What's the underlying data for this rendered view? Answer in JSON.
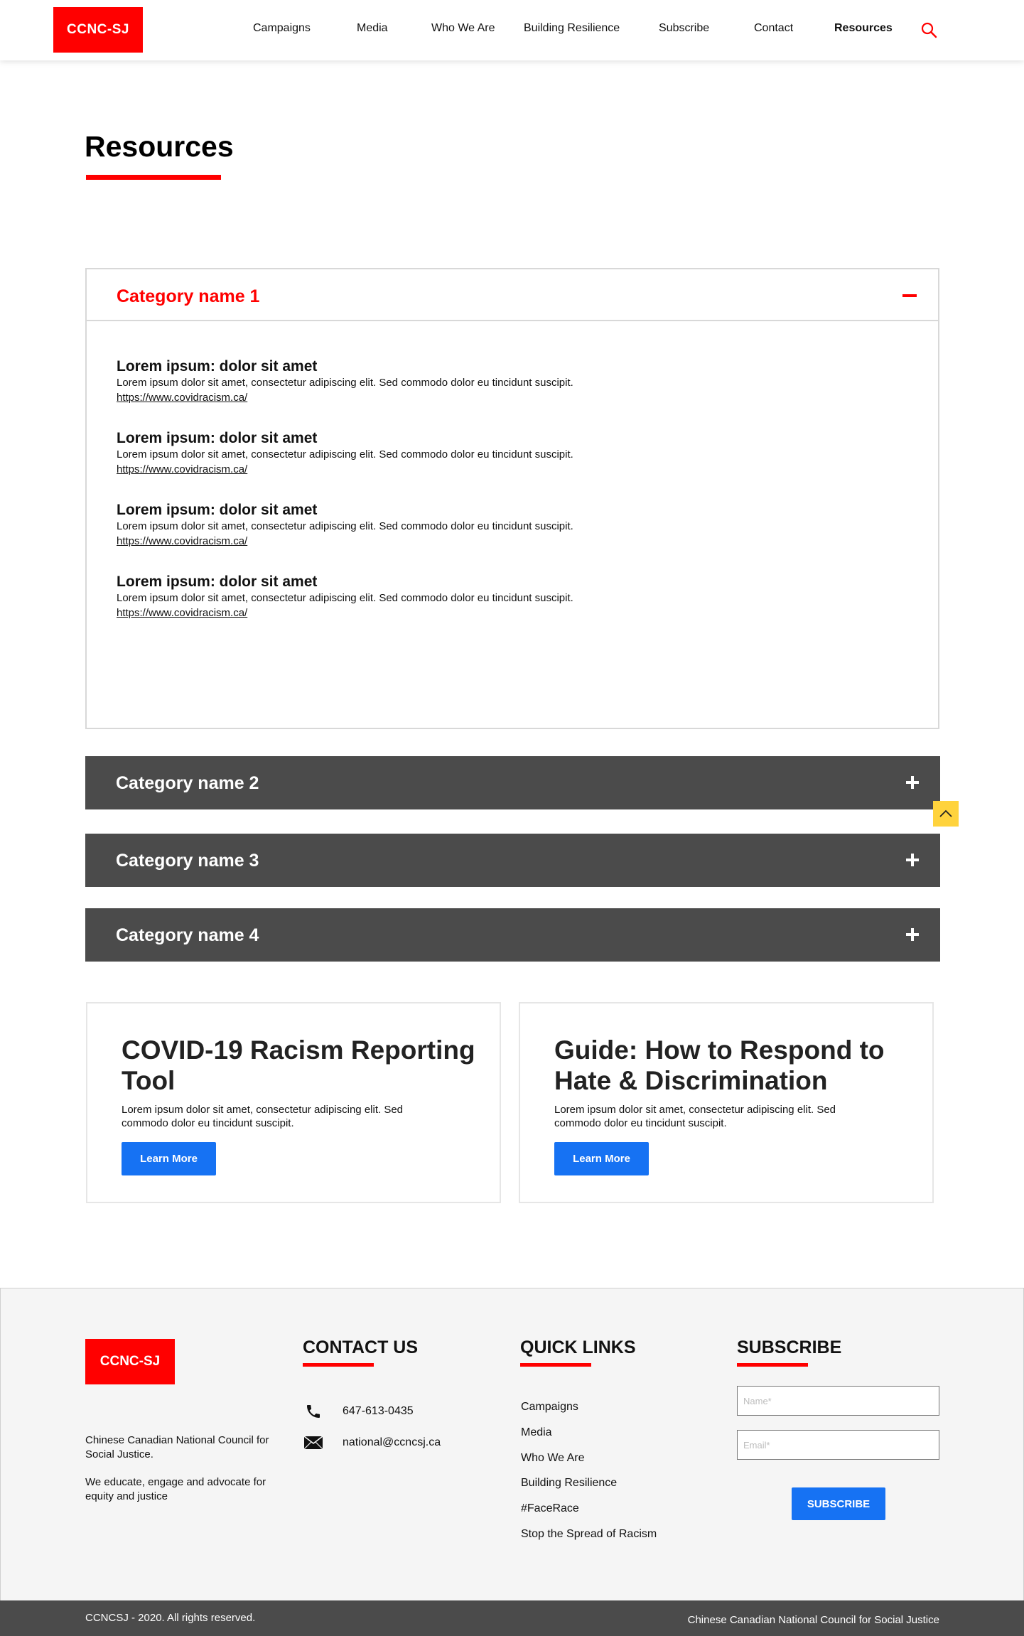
{
  "header": {
    "logo": "CCNC-SJ",
    "nav": [
      "Campaigns",
      "Media",
      "Who We Are",
      "Building Resilience",
      "Subscribe",
      "Contact",
      "Resources"
    ],
    "active_nav": "Resources",
    "search_icon": "search-icon"
  },
  "page": {
    "title": "Resources"
  },
  "accordion": {
    "open": {
      "title": "Category name 1",
      "items": [
        {
          "title": "Lorem ipsum: dolor sit amet",
          "desc": "Lorem ipsum dolor sit amet, consectetur adipiscing elit. Sed commodo dolor eu tincidunt suscipit.",
          "link": "https://www.covidracism.ca/"
        },
        {
          "title": "Lorem ipsum: dolor sit amet",
          "desc": "Lorem ipsum dolor sit amet, consectetur adipiscing elit. Sed commodo dolor eu tincidunt suscipit.",
          "link": "https://www.covidracism.ca/"
        },
        {
          "title": "Lorem ipsum: dolor sit amet",
          "desc": "Lorem ipsum dolor sit amet, consectetur adipiscing elit. Sed commodo dolor eu tincidunt suscipit.",
          "link": "https://www.covidracism.ca/"
        },
        {
          "title": "Lorem ipsum: dolor sit amet",
          "desc": "Lorem ipsum dolor sit amet, consectetur adipiscing elit. Sed commodo dolor eu tincidunt suscipit.",
          "link": "https://www.covidracism.ca/"
        }
      ]
    },
    "closed": [
      "Category name 2",
      "Category name 3",
      "Category name 4"
    ]
  },
  "cards": [
    {
      "title": "COVID-19 Racism Reporting Tool",
      "desc": "Lorem ipsum dolor sit amet, consectetur adipiscing elit. Sed commodo dolor eu tincidunt suscipit.",
      "button": "Learn More"
    },
    {
      "title": "Guide: How to Respond to Hate & Discrimination",
      "desc": "Lorem ipsum dolor sit amet, consectetur adipiscing elit. Sed commodo dolor eu tincidunt suscipit.",
      "button": "Learn More"
    }
  ],
  "footer": {
    "logo": "CCNC-SJ",
    "org_name": "Chinese Canadian National Council for Social Justice.",
    "mission": "We educate, engage and advocate for equity and justice",
    "contact": {
      "heading": "CONTACT US",
      "phone": "647-613-0435",
      "email": "national@ccncsj.ca"
    },
    "quick_links": {
      "heading": "QUICK LINKS",
      "items": [
        "Campaigns",
        "Media",
        "Who We Are",
        "Building Resilience",
        "#FaceRace",
        "Stop the Spread of Racism"
      ]
    },
    "subscribe": {
      "heading": "SUBSCRIBE",
      "name_placeholder": "Name*",
      "email_placeholder": "Email*",
      "button": "SUBSCRIBE"
    },
    "copyright": "CCNCSJ - 2020. All rights reserved.",
    "org_footer": "Chinese Canadian National Council for Social Justice"
  },
  "colors": {
    "brand_red": "#ff0000",
    "button_blue": "#1672f3",
    "dark_bar": "#4b4b4b",
    "back_to_top": "#ffd33d"
  }
}
